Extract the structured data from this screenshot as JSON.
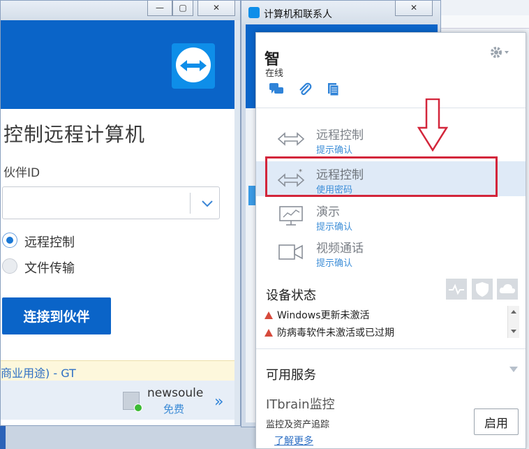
{
  "left_window": {
    "heading": "控制远程计算机",
    "partner_id_label": "伙伴ID",
    "partner_id_value": "",
    "options": [
      {
        "label": "远程控制",
        "selected": true
      },
      {
        "label": "文件传输",
        "selected": false
      }
    ],
    "connect_button": "连接到伙伴",
    "license_text": "商业用途) - GT",
    "user": {
      "name": "newsoule",
      "plan": "免费"
    }
  },
  "middle_window": {
    "title": "计算机和联系人",
    "close_symbol": "✕"
  },
  "popup": {
    "contact_name": "智",
    "status": "在线",
    "actions": [
      {
        "main": "远程控制",
        "sub": "提示确认",
        "icon": "remote-control-icon",
        "selected": false
      },
      {
        "main": "远程控制",
        "sub": "使用密码",
        "icon": "remote-control-password-icon",
        "selected": true
      },
      {
        "main": "演示",
        "sub": "提示确认",
        "icon": "presentation-icon",
        "selected": false
      },
      {
        "main": "视频通话",
        "sub": "提示确认",
        "icon": "video-call-icon",
        "selected": false
      }
    ],
    "device_status_title": "设备状态",
    "warnings": [
      "Windows更新未激活",
      "防病毒软件未激活或已过期"
    ],
    "available_services_title": "可用服务",
    "service_name": "ITbrain监控",
    "service_desc": "监控及资产追踪",
    "enable_button": "启用",
    "learn_more": "了解更多"
  },
  "colors": {
    "brand_blue": "#0a64c8",
    "link_blue": "#3f8fd8",
    "highlight_red": "#d3263b",
    "warning_red": "#d64a3c"
  }
}
